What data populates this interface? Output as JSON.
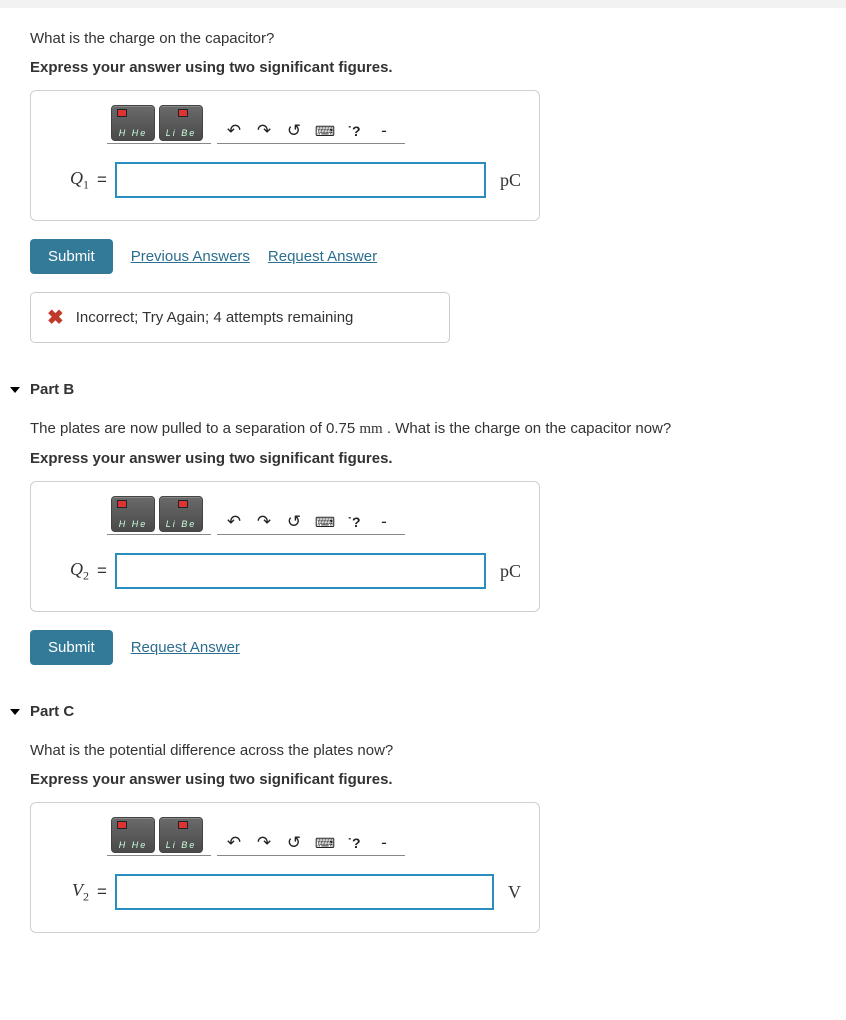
{
  "partA": {
    "prompt": "What is the charge on the capacitor?",
    "instruction": "Express your answer using two significant figures.",
    "variable_html": "Q<sub>1</sub>",
    "equals": "=",
    "unit": "pC",
    "input_value": "",
    "toolbar": {
      "undo_glyph": "↶",
      "redo_glyph": "↷",
      "reset_glyph": "↺",
      "keyboard_glyph": "⌨",
      "help_glyph": "?",
      "special_mark": "˙?",
      "dash": "-"
    },
    "submit_label": "Submit",
    "links": [
      "Previous Answers",
      "Request Answer"
    ],
    "feedback": "Incorrect; Try Again; 4 attempts remaining"
  },
  "partB": {
    "header": "Part B",
    "prompt_before": "The plates are now pulled to a separation of 0.75 ",
    "prompt_unit": "mm",
    "prompt_after": " . What is the charge on the capacitor now?",
    "instruction": "Express your answer using two significant figures.",
    "variable_html": "Q<sub>2</sub>",
    "equals": "=",
    "unit": "pC",
    "input_value": "",
    "submit_label": "Submit",
    "links": [
      "Request Answer"
    ]
  },
  "partC": {
    "header": "Part C",
    "prompt": "What is the potential difference across the plates now?",
    "instruction": "Express your answer using two significant figures.",
    "variable_html": "V<sub>2</sub>",
    "equals": "=",
    "unit": "V",
    "input_value": ""
  }
}
